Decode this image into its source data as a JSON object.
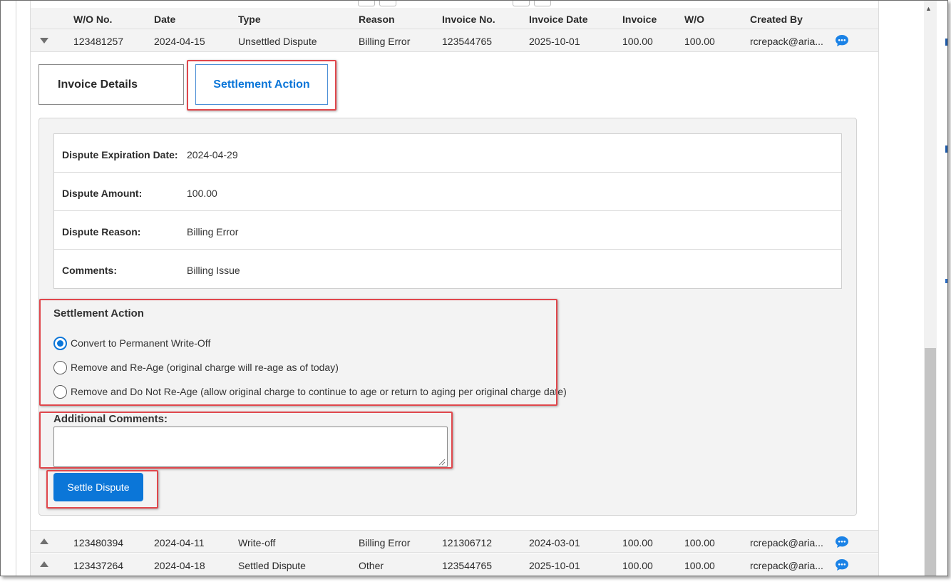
{
  "table": {
    "headers": [
      "W/O No.",
      "Date",
      "Type",
      "Reason",
      "Invoice No.",
      "Invoice Date",
      "Invoice",
      "W/O",
      "Created By"
    ],
    "rows": [
      {
        "wo_no": "123481257",
        "date": "2024-04-15",
        "type": "Unsettled Dispute",
        "reason": "Billing Error",
        "invoice_no": "123544765",
        "invoice_date": "2025-10-01",
        "invoice": "100.00",
        "wo": "100.00",
        "created_by": "rcrepack@aria...",
        "expanded": true
      },
      {
        "wo_no": "123480394",
        "date": "2024-04-11",
        "type": "Write-off",
        "reason": "Billing Error",
        "invoice_no": "121306712",
        "invoice_date": "2024-03-01",
        "invoice": "100.00",
        "wo": "100.00",
        "created_by": "rcrepack@aria...",
        "expanded": false
      },
      {
        "wo_no": "123437264",
        "date": "2024-04-18",
        "type": "Settled Dispute",
        "reason": "Other",
        "invoice_no": "123544765",
        "invoice_date": "2025-10-01",
        "invoice": "100.00",
        "wo": "100.00",
        "created_by": "rcrepack@aria...",
        "expanded": false
      }
    ]
  },
  "tabs": {
    "invoice_details": "Invoice Details",
    "settlement_action": "Settlement Action",
    "active": "settlement_action"
  },
  "details": {
    "expiration_label": "Dispute Expiration Date:",
    "expiration_value": "2024-04-29",
    "amount_label": "Dispute Amount:",
    "amount_value": "100.00",
    "reason_label": "Dispute Reason:",
    "reason_value": "Billing Error",
    "comments_label": "Comments:",
    "comments_value": "Billing Issue"
  },
  "settlement": {
    "title": "Settlement Action",
    "options": [
      {
        "label": "Convert to Permanent Write-Off",
        "checked": true
      },
      {
        "label": "Remove and Re-Age (original charge will re-age as of today)",
        "checked": false
      },
      {
        "label": "Remove and Do Not Re-Age (allow original charge to continue to age or return to aging per original charge date)",
        "checked": false
      }
    ]
  },
  "additional_comments": {
    "label": "Additional Comments:",
    "value": ""
  },
  "settle_button": "Settle Dispute",
  "colors": {
    "accent": "#0b76d8",
    "highlight": "#e0474c",
    "row_bg": "#f3f3f3"
  },
  "icons": {
    "expand": "triangle-down-icon",
    "collapse": "triangle-up-icon",
    "comment": "chat-bubble-icon"
  }
}
